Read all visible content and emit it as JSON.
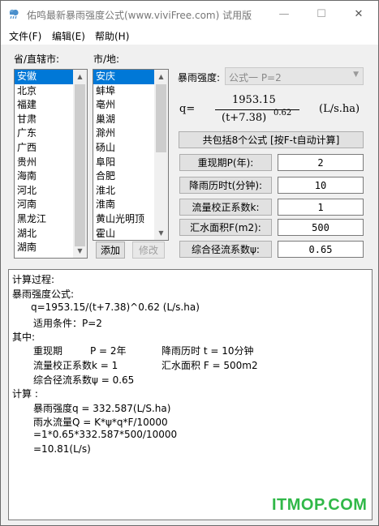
{
  "window": {
    "title": "佑鸣最新暴雨强度公式(www.viviFree.com) 试用版",
    "minimize_glyph": "—",
    "maximize_glyph": "☐",
    "close_glyph": "✕"
  },
  "menu": [
    {
      "label": "文件(F)"
    },
    {
      "label": "编辑(E)"
    },
    {
      "label": "帮助(H)"
    }
  ],
  "province": {
    "label": "省/直辖市:",
    "items": [
      "安徽",
      "北京",
      "福建",
      "甘肃",
      "广东",
      "广西",
      "贵州",
      "海南",
      "河北",
      "河南",
      "黑龙江",
      "湖北",
      "湖南"
    ],
    "selected": "安徽"
  },
  "city": {
    "label": "市/地:",
    "items": [
      "安庆",
      "蚌埠",
      "亳州",
      "巢湖",
      "滁州",
      "砀山",
      "阜阳",
      "合肥",
      "淮北",
      "淮南",
      "黄山光明顶",
      "霍山"
    ],
    "selected": "安庆"
  },
  "buttons": {
    "add": "添加",
    "modify": "修改",
    "calc": "共包括8个公式 [按F-t自动计算]"
  },
  "intensity": {
    "label": "暴雨强度:",
    "formula_option": "公式一  P=2"
  },
  "formula": {
    "lhs": "q=",
    "numerator": "1953.15",
    "denominator": "(t+7.38)",
    "exponent": "0.62",
    "unit": "(L/s.ha)"
  },
  "params": [
    {
      "label": "重现期P(年):",
      "value": "2"
    },
    {
      "label": "降雨历时t(分钟):",
      "value": "10"
    },
    {
      "label": "流量校正系数k:",
      "value": "1"
    },
    {
      "label": "汇水面积F(m2):",
      "value": "500"
    },
    {
      "label": "综合径流系数ψ:",
      "value": "0.65"
    }
  ],
  "result": {
    "lines": [
      "计算过程:",
      "暴雨强度公式:",
      "q=1953.15/(t+7.38)^0.62 (L/s.ha)",
      "适用条件：P=2",
      "其中:",
      "重现期",
      "P = 2年",
      "降雨历时 t = 10分钟",
      "流量校正系数k = 1",
      "汇水面积 F = 500m2",
      "综合径流系数ψ = 0.65",
      "计算 :",
      "暴雨强度q = 332.587(L/S.ha)",
      "雨水流量Q = K*ψ*q*F/10000",
      "=1*0.65*332.587*500/10000",
      "=10.81(L/s)"
    ]
  },
  "watermark": "ITMOP.COM",
  "colors": {
    "selection": "#0078d7",
    "watermark": "#30b848",
    "window_bg": "#f0f0f0"
  }
}
